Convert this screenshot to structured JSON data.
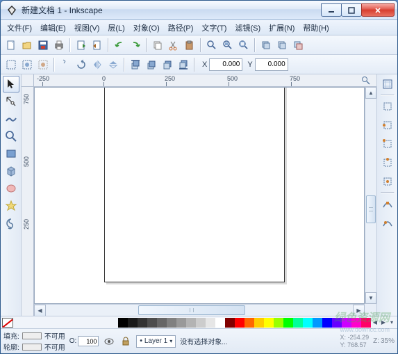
{
  "title": "新建文档 1 - Inkscape",
  "menus": {
    "file": "文件(F)",
    "edit": "编辑(E)",
    "view": "视图(V)",
    "layer": "层(L)",
    "object": "对象(O)",
    "path": "路径(P)",
    "text": "文字(T)",
    "filter": "滤镜(S)",
    "extension": "扩展(N)",
    "help": "帮助(H)"
  },
  "toolbar2": {
    "x_label": "X",
    "x_value": "0.000",
    "y_label": "Y",
    "y_value": "0.000"
  },
  "ruler": {
    "m250": "-250",
    "p0": "0",
    "p250": "250",
    "p500": "500",
    "p750": "750",
    "v750": "750",
    "v500": "500",
    "v250": "250"
  },
  "palette": [
    "#000000",
    "#1a1a1a",
    "#333333",
    "#4d4d4d",
    "#666666",
    "#808080",
    "#999999",
    "#b3b3b3",
    "#cccccc",
    "#e6e6e6",
    "#ffffff",
    "#800000",
    "#ff0000",
    "#ff6600",
    "#ffcc00",
    "#ffff00",
    "#99ff00",
    "#00ff00",
    "#00ff99",
    "#00ffff",
    "#0099ff",
    "#0000ff",
    "#6600ff",
    "#cc00ff",
    "#ff00cc",
    "#ff0066"
  ],
  "status": {
    "fill_label": "填充:",
    "fill_value": "不可用",
    "stroke_label": "轮廓:",
    "stroke_value": "不可用",
    "opacity_label": "O:",
    "opacity_value": "100",
    "layer_label": "Layer 1",
    "message": "没有选择对象...",
    "x_label": "X:",
    "x_value": "-254.29",
    "y_label": "Y:",
    "y_value": "768.57",
    "z_label": "Z:",
    "z_value": "35%"
  },
  "watermark": {
    "main": "绿色资源网",
    "sub": "www.downcc.com"
  }
}
